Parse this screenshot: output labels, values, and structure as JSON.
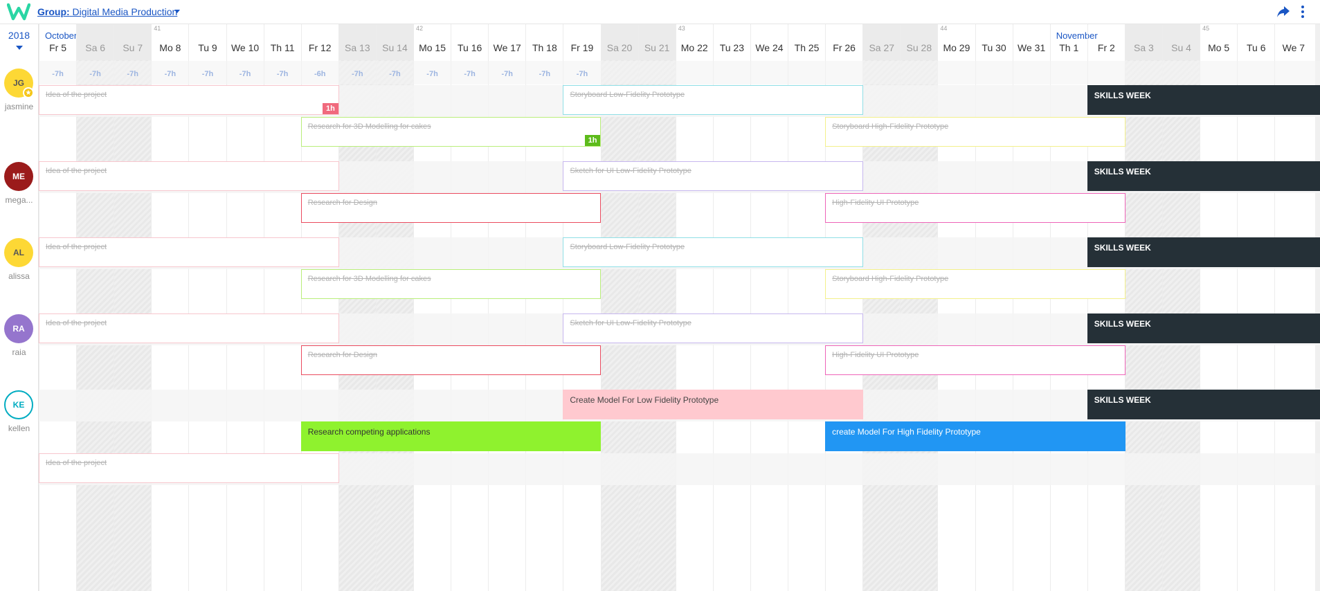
{
  "header": {
    "group_prefix": "Group:",
    "group_name": "Digital Media Production",
    "colors": {
      "brand": "#2ad6a4",
      "link": "#1a56c4"
    }
  },
  "calendar": {
    "year": "2018",
    "months": [
      {
        "label": "October",
        "col": 0
      },
      {
        "label": "November",
        "col": 27
      }
    ],
    "weeks": [
      {
        "label": "41",
        "col": 3
      },
      {
        "label": "42",
        "col": 10
      },
      {
        "label": "43",
        "col": 17
      },
      {
        "label": "44",
        "col": 24
      },
      {
        "label": "45",
        "col": 31
      }
    ],
    "days": [
      "Fr 5",
      "Sa 6",
      "Su 7",
      "Mo 8",
      "Tu 9",
      "We 10",
      "Th 11",
      "Fr 12",
      "Sa 13",
      "Su 14",
      "Mo 15",
      "Tu 16",
      "We 17",
      "Th 18",
      "Fr 19",
      "Sa 20",
      "Su 21",
      "Mo 22",
      "Tu 23",
      "We 24",
      "Th 25",
      "Fr 26",
      "Sa 27",
      "Su 28",
      "Mo 29",
      "Tu 30",
      "We 31",
      "Th 1",
      "Fr 2",
      "Sa 3",
      "Su 4",
      "Mo 5",
      "Tu 6",
      "We 7"
    ],
    "weekends": [
      1,
      2,
      8,
      9,
      15,
      16,
      22,
      23,
      29,
      30
    ],
    "hours": [
      "-7h",
      "-7h",
      "-7h",
      "-7h",
      "-7h",
      "-7h",
      "-7h",
      "-6h",
      "-7h",
      "-7h",
      "-7h",
      "-7h",
      "-7h",
      "-7h",
      "-7h"
    ]
  },
  "users": [
    {
      "initials": "JG",
      "name": "jasmine",
      "color": "#fdd835",
      "text_color": "#555555",
      "starred": true
    },
    {
      "initials": "ME",
      "name": "mega...",
      "color": "#9b1b1b",
      "text_color": "#ffffff",
      "starred": false
    },
    {
      "initials": "AL",
      "name": "alissa",
      "color": "#fdd835",
      "text_color": "#555555",
      "starred": false
    },
    {
      "initials": "RA",
      "name": "raia",
      "color": "#9575cd",
      "text_color": "#ffffff",
      "starred": false
    },
    {
      "initials": "KE",
      "name": "kellen",
      "color": "#ffffff",
      "text_color": "#00acc1",
      "border": "#00acc1",
      "starred": false
    }
  ],
  "tasks": [
    {
      "label": "Idea of the project",
      "row": 0,
      "start": 0,
      "span": 8,
      "done": true,
      "border": "#f7c6cd",
      "badge": "1h",
      "badge_color": "#f06a7d"
    },
    {
      "label": "Storyboard Low-Fidelity Prototype",
      "row": 0,
      "start": 14,
      "span": 8,
      "done": true,
      "border": "#8fdfe6"
    },
    {
      "label": "SKILLS WEEK",
      "row": 0,
      "start": 28,
      "span": 7,
      "style": "dark"
    },
    {
      "label": "Research for 3D Modelling for cakes",
      "row": 1,
      "start": 7,
      "span": 8,
      "done": true,
      "border": "#b9ee7a",
      "badge": "1h",
      "badge_color": "#5dbb1b"
    },
    {
      "label": "Storyboard High-Fidelity Prototype",
      "row": 1,
      "start": 21,
      "span": 8,
      "done": true,
      "border": "#f3f08a"
    },
    {
      "label": "Idea of the project",
      "row": 2,
      "start": 0,
      "span": 8,
      "done": true,
      "border": "#f7c6cd"
    },
    {
      "label": "Sketch for UI Low-Fidelity Prototype",
      "row": 2,
      "start": 14,
      "span": 8,
      "done": true,
      "border": "#c6b6ee"
    },
    {
      "label": "SKILLS WEEK",
      "row": 2,
      "start": 28,
      "span": 7,
      "style": "dark"
    },
    {
      "label": "Research for Design",
      "row": 3,
      "start": 7,
      "span": 8,
      "done": true,
      "border": "#ea4a5e"
    },
    {
      "label": "High-Fidelity UI Prototype",
      "row": 3,
      "start": 21,
      "span": 8,
      "done": true,
      "border": "#ee64b8"
    },
    {
      "label": "Idea of the project",
      "row": 4,
      "start": 0,
      "span": 8,
      "done": true,
      "border": "#f7c6cd"
    },
    {
      "label": "Storyboard Low-Fidelity Prototype",
      "row": 4,
      "start": 14,
      "span": 8,
      "done": true,
      "border": "#8fdfe6"
    },
    {
      "label": "SKILLS WEEK",
      "row": 4,
      "start": 28,
      "span": 7,
      "style": "dark"
    },
    {
      "label": "Research for 3D Modelling for cakes",
      "row": 5,
      "start": 7,
      "span": 8,
      "done": true,
      "border": "#b9ee7a"
    },
    {
      "label": "Storyboard High-Fidelity Prototype",
      "row": 5,
      "start": 21,
      "span": 8,
      "done": true,
      "border": "#f3f08a"
    },
    {
      "label": "Idea of the project",
      "row": 6,
      "start": 0,
      "span": 8,
      "done": true,
      "border": "#f7c6cd"
    },
    {
      "label": "Sketch for UI Low-Fidelity Prototype",
      "row": 6,
      "start": 14,
      "span": 8,
      "done": true,
      "border": "#c6b6ee"
    },
    {
      "label": "SKILLS WEEK",
      "row": 6,
      "start": 28,
      "span": 7,
      "style": "dark"
    },
    {
      "label": "Research for Design",
      "row": 7,
      "start": 7,
      "span": 8,
      "done": true,
      "border": "#ea4a5e"
    },
    {
      "label": "High-Fidelity UI Prototype",
      "row": 7,
      "start": 21,
      "span": 8,
      "done": true,
      "border": "#ee64b8"
    },
    {
      "label": "Create Model For Low Fidelity Prototype",
      "row": 8,
      "start": 14,
      "span": 8,
      "style": "filled-pink"
    },
    {
      "label": "SKILLS WEEK",
      "row": 8,
      "start": 28,
      "span": 7,
      "style": "dark"
    },
    {
      "label": "Research competing applications",
      "row": 9,
      "start": 7,
      "span": 8,
      "style": "filled-green"
    },
    {
      "label": "create Model For High Fidelity Prototype",
      "row": 9,
      "start": 21,
      "span": 8,
      "style": "filled-blue"
    },
    {
      "label": "Idea of the project",
      "row": 10,
      "start": 0,
      "span": 8,
      "done": true,
      "border": "#f7c6cd"
    }
  ]
}
